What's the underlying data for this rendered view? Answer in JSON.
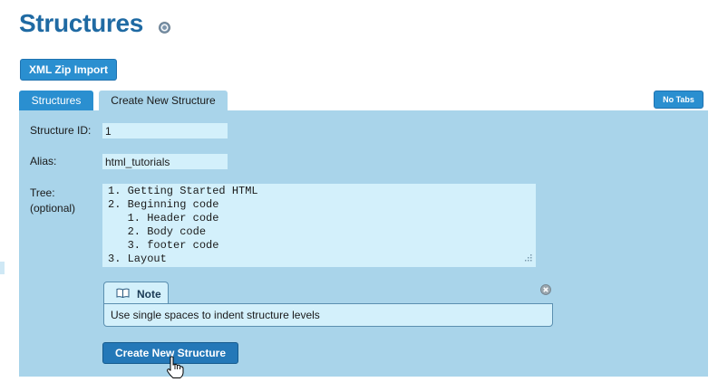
{
  "header": {
    "title": "Structures"
  },
  "toolbar": {
    "xml_import_label": "XML Zip Import"
  },
  "tabs": [
    {
      "label": "Structures",
      "active": false
    },
    {
      "label": "Create New Structure",
      "active": true
    }
  ],
  "no_tabs_label": "No Tabs",
  "form": {
    "structure_id_label": "Structure ID:",
    "structure_id_value": "1",
    "alias_label": "Alias:",
    "alias_value": "html_tutorials",
    "tree_label_line1": "Tree:",
    "tree_label_line2": "(optional)",
    "tree_value": "1. Getting Started HTML\n2. Beginning code\n   1. Header code\n   2. Body code\n   3. footer code\n3. Layout"
  },
  "note": {
    "title": "Note",
    "text": "Use single spaces to indent structure levels"
  },
  "submit_label": "Create New Structure",
  "colors": {
    "title": "#1f6aa3",
    "button": "#2a8fd0",
    "panel": "#a9d4ea",
    "input": "#d3f0fb"
  }
}
